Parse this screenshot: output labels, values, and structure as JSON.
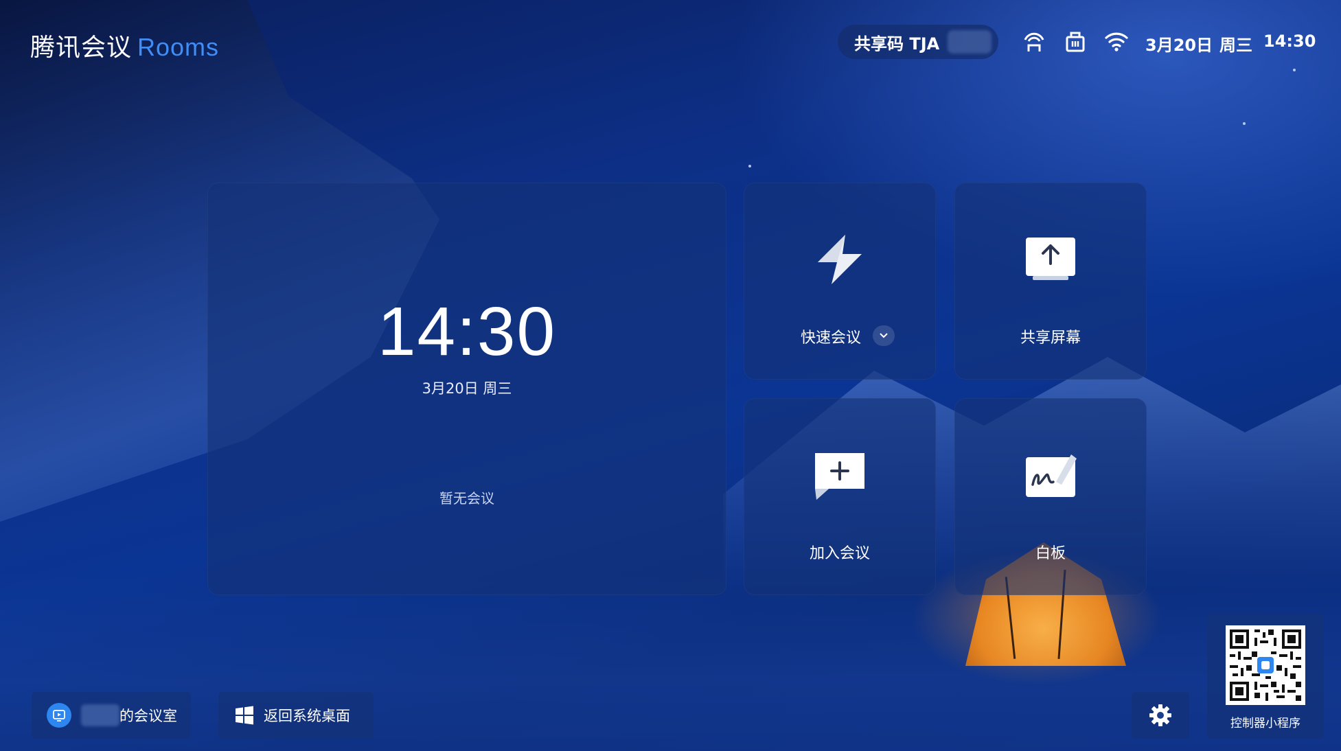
{
  "app": {
    "brand_cn": "腾讯会议",
    "brand_en": "Rooms"
  },
  "status_bar": {
    "share_code_label": "共享码 TJA",
    "date": "3月20日",
    "weekday": "周三",
    "time": "14:30",
    "icons": [
      "cast-icon",
      "network-icon",
      "wifi-icon"
    ]
  },
  "clock_card": {
    "time": "14:30",
    "date": "3月20日  周三",
    "empty_text": "暂无会议"
  },
  "tiles": {
    "quick_meeting": {
      "label": "快速会议",
      "icon": "lightning-icon"
    },
    "share_screen": {
      "label": "共享屏幕",
      "icon": "share-screen-icon"
    },
    "join_meeting": {
      "label": "加入会议",
      "icon": "join-meeting-icon"
    },
    "whiteboard": {
      "label": "白板",
      "icon": "whiteboard-icon"
    }
  },
  "bottom_bar": {
    "room_label": "的会议室",
    "desktop_label": "返回系统桌面",
    "qr_label": "控制器小程序"
  },
  "colors": {
    "brand_accent": "#3f8df5",
    "panel_bg": "rgba(20,50,120,0.62)"
  }
}
